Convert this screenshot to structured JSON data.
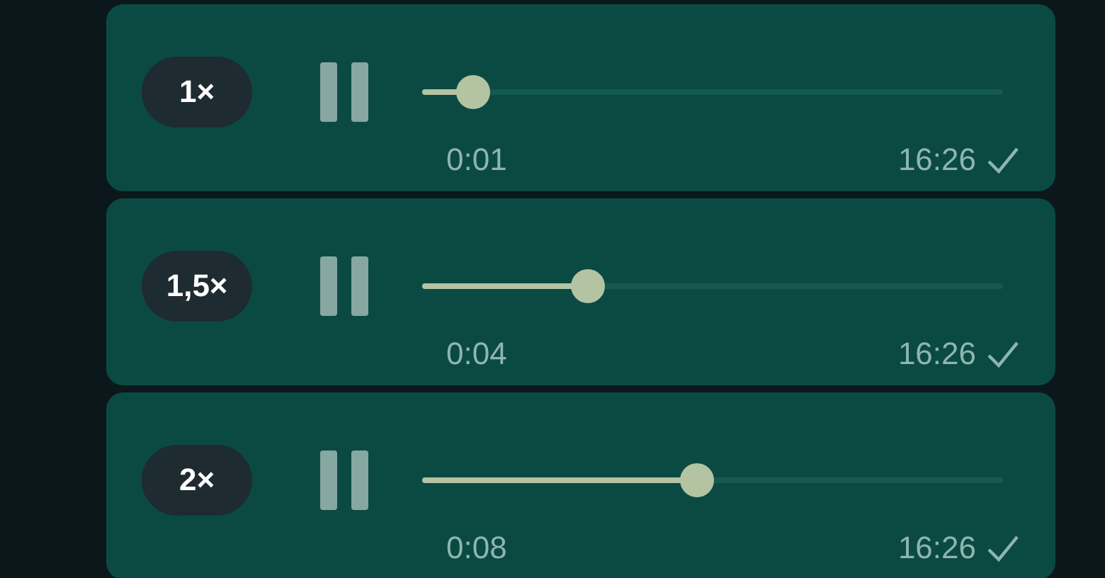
{
  "messages": [
    {
      "speed": "1×",
      "level": 0.088,
      "elapsed": "0:01",
      "time": "16:26"
    },
    {
      "speed": "1,5×",
      "level": 0.285,
      "elapsed": "0:04",
      "time": "16:26"
    },
    {
      "speed": "2×",
      "level": 0.473,
      "elapsed": "0:08",
      "time": "16:26"
    }
  ]
}
